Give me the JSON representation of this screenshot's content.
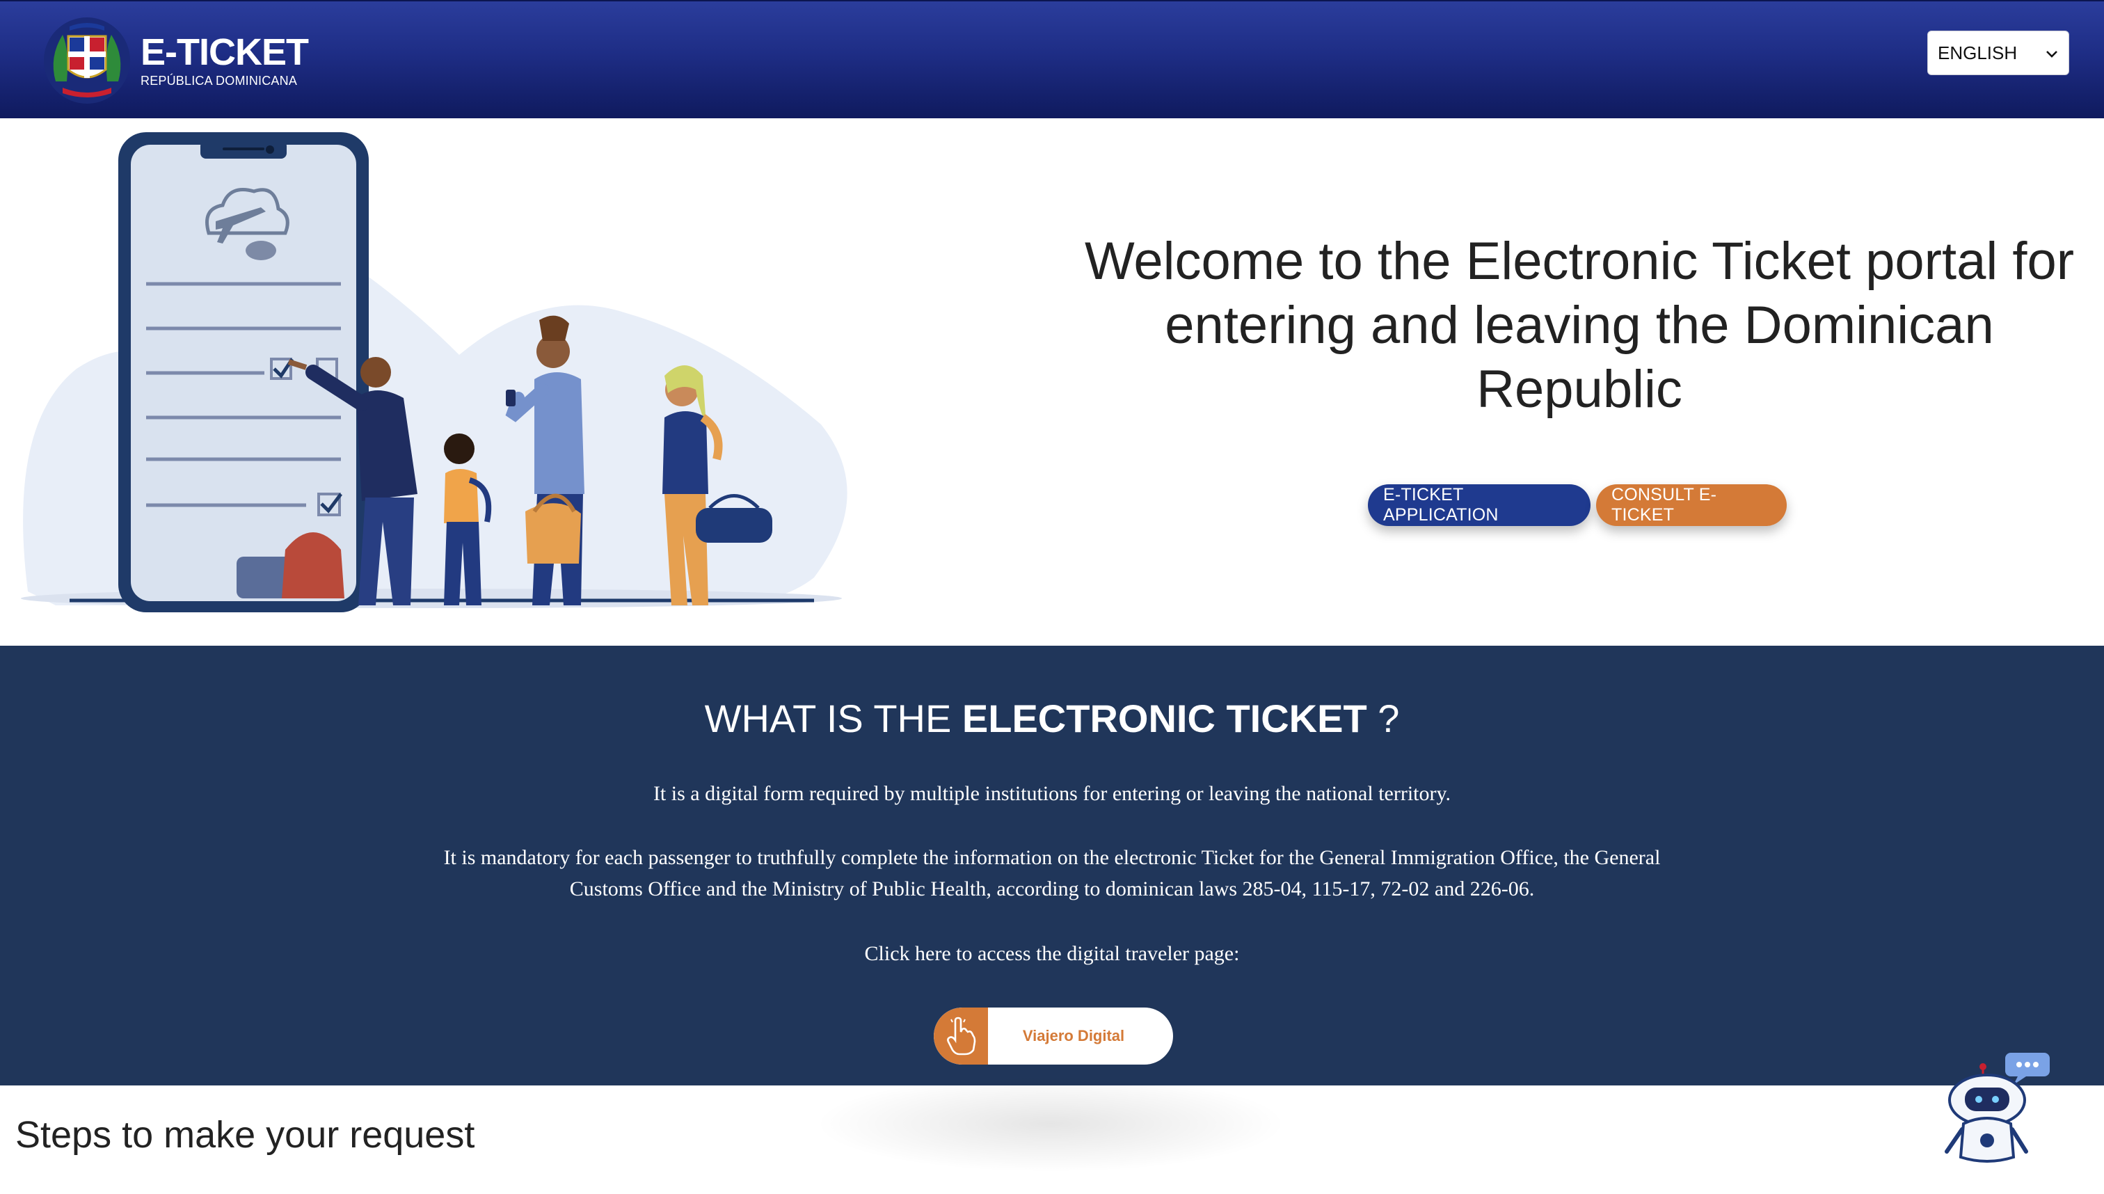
{
  "header": {
    "brand_title": "E-TICKET",
    "brand_subtitle": "REPÚBLICA DOMINICANA",
    "language_selected": "ENGLISH"
  },
  "hero": {
    "welcome_text": "Welcome to the Electronic Ticket portal for entering and leaving the Dominican Republic",
    "apply_button": "E-TICKET APPLICATION",
    "consult_button": "CONSULT E-TICKET"
  },
  "info": {
    "title_prefix": "WHAT IS THE",
    "title_strong": "ELECTRONIC TICKET",
    "title_suffix": "?",
    "paragraph_1": "It is a digital form required by multiple institutions for entering or leaving the national territory.",
    "paragraph_2": "It is mandatory for each passenger to truthfully complete the information on the electronic Ticket for the General Immigration Office, the General Customs Office and the Ministry of Public Health, according to dominican laws 285-04, 115-17, 72-02 and 226-06.",
    "paragraph_3": "Click here to access the digital traveler page:",
    "viajero_button": "Viajero Digital"
  },
  "steps": {
    "title": "Steps to make your request"
  },
  "colors": {
    "header_blue": "#1e2d85",
    "section_navy": "#20365a",
    "accent_orange": "#d47a37",
    "button_blue": "#1f3a8f"
  },
  "icons": {
    "crest": "national-coat-of-arms-icon",
    "language_chevron": "chevron-down-icon",
    "viajero_hand": "pointer-hand-icon",
    "chatbot": "robot-chat-icon"
  }
}
